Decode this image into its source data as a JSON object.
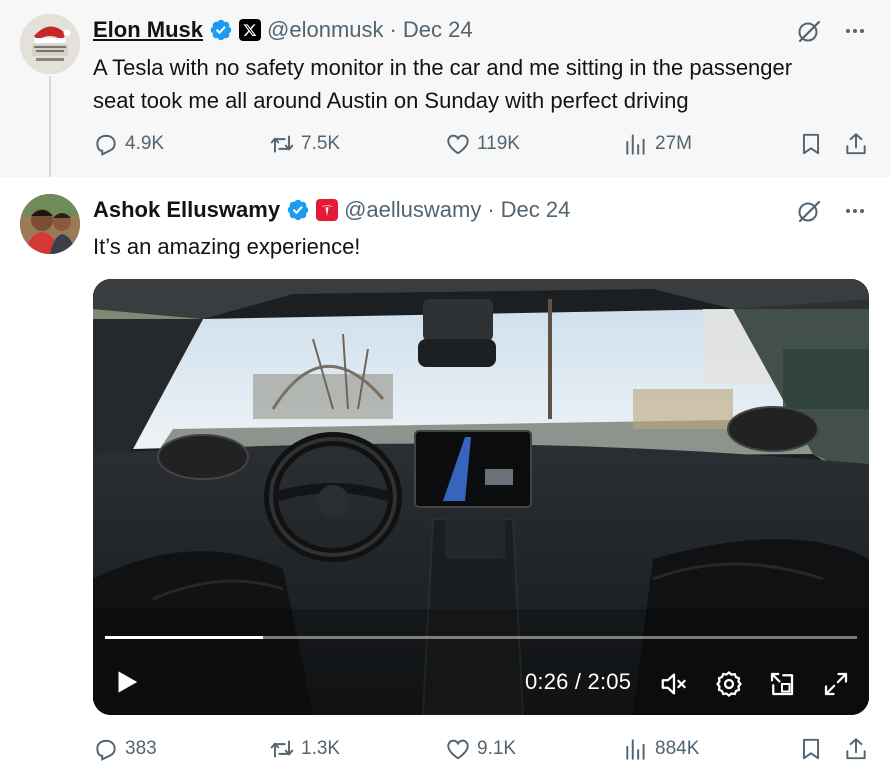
{
  "tweets": [
    {
      "display_name": "Elon Musk",
      "handle": "@elonmusk",
      "separator": "·",
      "date": "Dec 24",
      "affiliation": "X",
      "text_lines": [
        "A Tesla with no safety monitor in the car and me sitting in the passenger",
        "seat took me all around Austin on Sunday with perfect driving"
      ],
      "stats": {
        "replies": "4.9K",
        "reposts": "7.5K",
        "likes": "119K",
        "views": "27M"
      }
    },
    {
      "display_name": "Ashok Elluswamy",
      "handle": "@aelluswamy",
      "separator": "·",
      "date": "Dec 24",
      "affiliation": "Tesla",
      "text": "It’s an amazing experience!",
      "stats": {
        "replies": "383",
        "reposts": "1.3K",
        "likes": "9.1K",
        "views": "884K"
      }
    }
  ],
  "video": {
    "current_time": "0:26",
    "duration": "2:05",
    "time_display": "0:26 / 2:05",
    "progress_fraction": 0.21,
    "muted": true
  },
  "colors": {
    "verified_blue": "#1d9bf0",
    "muted_text": "#536471",
    "thread_line": "#cfd9de",
    "tesla_red": "#e31937",
    "focused_bg": "#f7f7f7"
  },
  "icons": [
    "verified-badge-icon",
    "x-logo-icon",
    "tesla-logo-icon",
    "grok-icon",
    "more-icon",
    "reply-icon",
    "repost-icon",
    "like-icon",
    "views-icon",
    "bookmark-icon",
    "share-icon",
    "play-icon",
    "mute-icon",
    "settings-icon",
    "pip-icon",
    "fullscreen-icon"
  ]
}
